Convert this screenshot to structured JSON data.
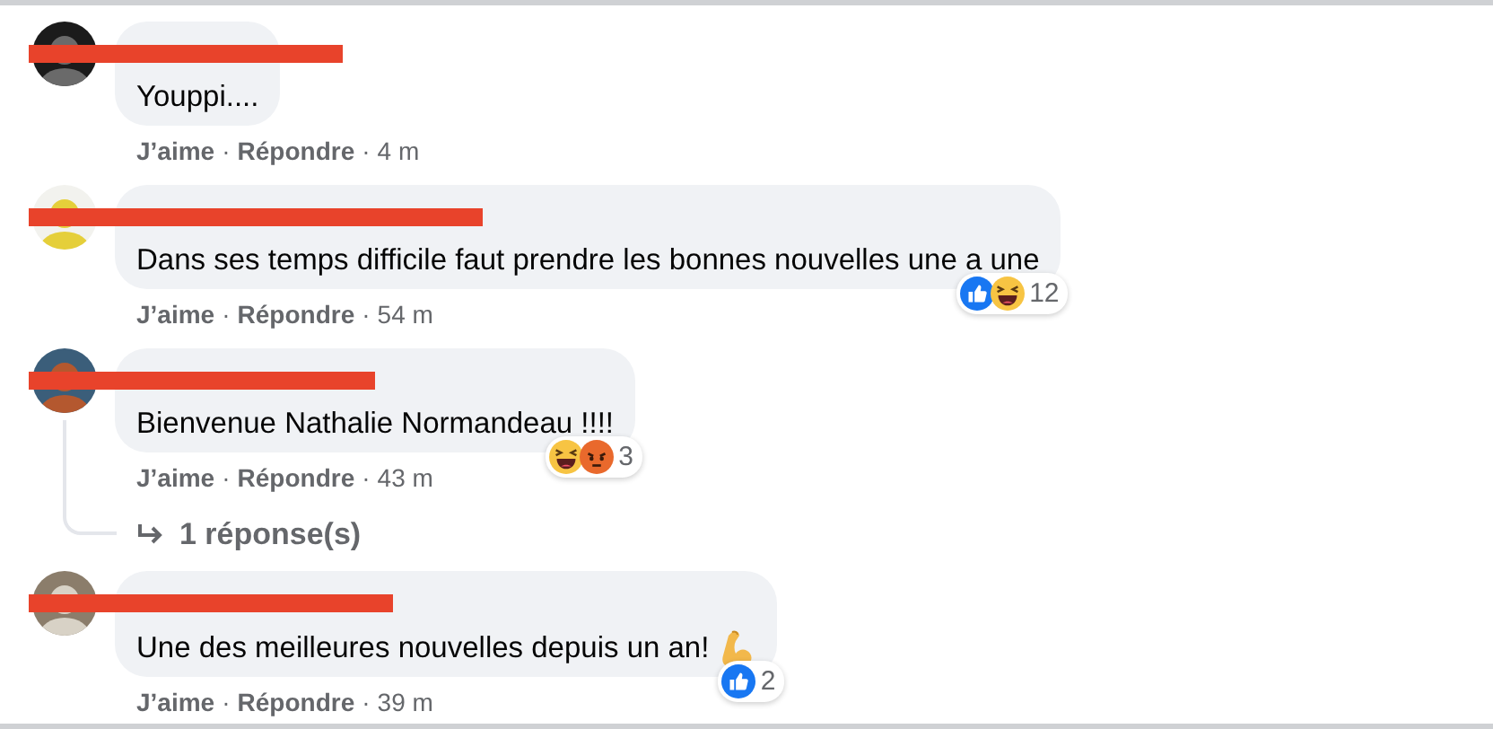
{
  "comments": [
    {
      "text": "Youppi....",
      "redacted_name": true,
      "actions": [
        {
          "kind": "link",
          "text": "J’aime"
        },
        {
          "kind": "separator",
          "text": "·"
        },
        {
          "kind": "link",
          "text": "Répondre"
        },
        {
          "kind": "separator",
          "text": "·"
        },
        {
          "kind": "time",
          "text": "4 m"
        }
      ]
    },
    {
      "text": "Dans ses temps difficile faut prendre les bonnes nouvelles une a une",
      "redacted_name": true,
      "reactions": {
        "icons": [
          {
            "kind": "like"
          },
          {
            "kind": "haha"
          }
        ],
        "count": "12"
      },
      "actions": [
        {
          "kind": "link",
          "text": "J’aime"
        },
        {
          "kind": "separator",
          "text": "·"
        },
        {
          "kind": "link",
          "text": "Répondre"
        },
        {
          "kind": "separator",
          "text": "·"
        },
        {
          "kind": "time",
          "text": "54 m"
        }
      ]
    },
    {
      "text": "Bienvenue Nathalie Normandeau !!!!",
      "redacted_name": true,
      "reactions": {
        "icons": [
          {
            "kind": "haha"
          },
          {
            "kind": "angry"
          }
        ],
        "count": "3"
      },
      "actions": [
        {
          "kind": "link",
          "text": "J’aime"
        },
        {
          "kind": "separator",
          "text": "·"
        },
        {
          "kind": "link",
          "text": "Répondre"
        },
        {
          "kind": "separator",
          "text": "·"
        },
        {
          "kind": "time",
          "text": "43 m"
        }
      ],
      "replies_link": "1 réponse(s)"
    },
    {
      "text": "Une des meilleures nouvelles depuis un an!",
      "trailing_emoji": {
        "kind": "muscle"
      },
      "redacted_name": true,
      "reactions": {
        "icons": [
          {
            "kind": "like"
          }
        ],
        "count": "2"
      },
      "actions": [
        {
          "kind": "link",
          "text": "J’aime"
        },
        {
          "kind": "separator",
          "text": "·"
        },
        {
          "kind": "link",
          "text": "Répondre"
        },
        {
          "kind": "separator",
          "text": "·"
        },
        {
          "kind": "time",
          "text": "39 m"
        }
      ]
    }
  ]
}
